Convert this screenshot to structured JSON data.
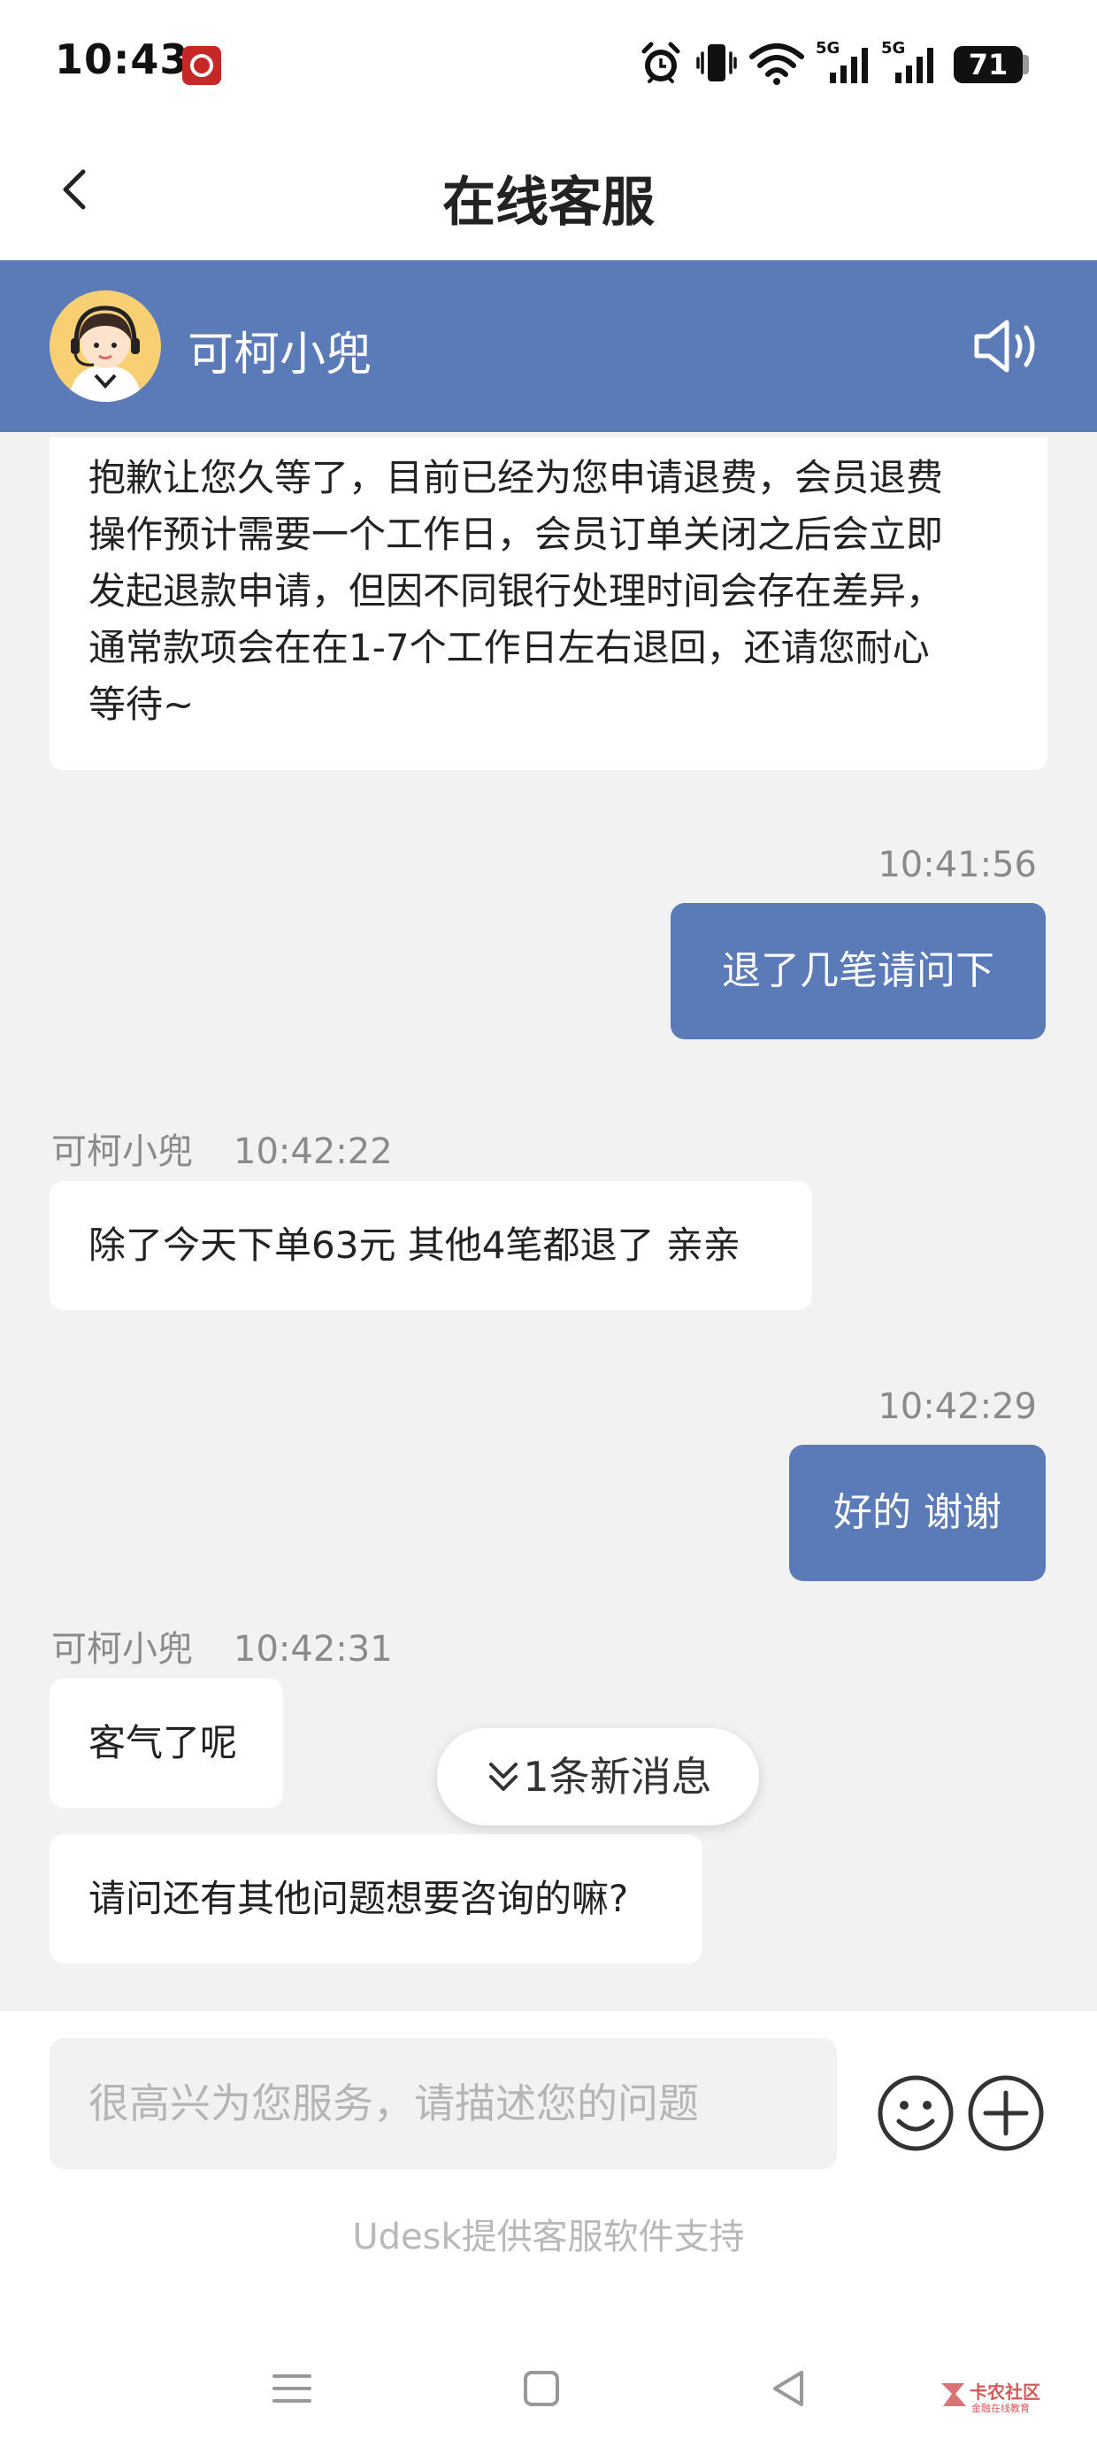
{
  "status_bar": {
    "time": "10:43",
    "battery": "71",
    "network_1": "5G",
    "network_2": "5G",
    "icons": [
      "bank-app-icon",
      "alarm-icon",
      "vibrate-icon",
      "wifi-icon",
      "signal-5g-icon",
      "signal-5g-icon",
      "battery-icon"
    ]
  },
  "header": {
    "title": "在线客服",
    "back_icon": "chevron-left-icon"
  },
  "agent": {
    "name": "可柯小兜",
    "avatar_icon": "customer-service-agent-avatar",
    "speaker_icon": "speaker-icon"
  },
  "messages": [
    {
      "direction": "incoming",
      "lines": [
        "抱歉让您久等了，目前已经为您申请退费，会员退费",
        "操作预计需要一个工作日，会员订单关闭之后会立即",
        "发起退款申请，但因不同银行处理时间会存在差异，",
        "通常款项会在在1-7个工作日左右退回，还请您耐心",
        "等待~"
      ]
    },
    {
      "direction": "outgoing",
      "time": "10:41:56",
      "text": "退了几笔请问下"
    },
    {
      "direction": "incoming",
      "sender": "可柯小兜",
      "time": "10:42:22",
      "text": "除了今天下单63元 其他4笔都退了 亲亲"
    },
    {
      "direction": "outgoing",
      "time": "10:42:29",
      "text": "好的 谢谢"
    },
    {
      "direction": "incoming",
      "sender": "可柯小兜",
      "time": "10:42:31",
      "text": "客气了呢"
    },
    {
      "direction": "incoming",
      "text": "请问还有其他问题想要咨询的嘛?"
    }
  ],
  "new_messages_pill": {
    "label": "1条新消息",
    "icon": "double-chevron-down-icon"
  },
  "input": {
    "placeholder": "很高兴为您服务，请描述您的问题",
    "value": ""
  },
  "toolbar": {
    "emoji_icon": "emoji-icon",
    "plus_icon": "plus-circle-icon"
  },
  "footer": {
    "powered_by": "Udesk提供客服软件支持"
  },
  "nav_bar": {
    "icons": [
      "menu-icon",
      "home-square-icon",
      "back-triangle-icon"
    ]
  },
  "watermark": {
    "text": "卡农社区",
    "subtext": "金融在线教育"
  },
  "colors": {
    "accent": "#5b7ab8",
    "background": "#f2f2f2",
    "bubble_in": "#ffffff",
    "muted_text": "#8a8a8a"
  }
}
